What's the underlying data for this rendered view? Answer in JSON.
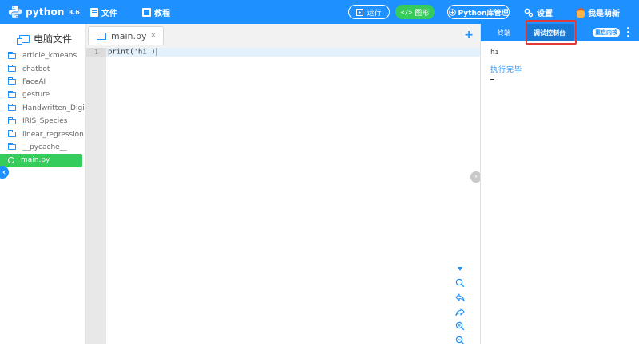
{
  "app": {
    "name": "python",
    "version": "3.6",
    "brand_color": "#1e90ff",
    "accent_green": "#36cc5c"
  },
  "topbar": {
    "file_label": "文件",
    "tutorial_label": "教程",
    "run_label": "运行",
    "graph_label": "图形",
    "lib_label": "Python库管理",
    "settings_label": "设置",
    "user_label": "我是萌新"
  },
  "sidebar": {
    "title": "电脑文件",
    "items": [
      {
        "label": "article_kmeans",
        "icon": "folder-icon"
      },
      {
        "label": "chatbot",
        "icon": "folder-icon"
      },
      {
        "label": "FaceAI",
        "icon": "folder-icon"
      },
      {
        "label": "gesture",
        "icon": "folder-icon"
      },
      {
        "label": "Handwritten_Digit...",
        "icon": "folder-icon"
      },
      {
        "label": "IRIS_Species",
        "icon": "folder-icon"
      },
      {
        "label": "linear_regression",
        "icon": "folder-icon"
      },
      {
        "label": "__pycache__",
        "icon": "folder-icon"
      },
      {
        "label": "main.py",
        "icon": "python-file-icon",
        "active": true
      }
    ]
  },
  "editor": {
    "tab_label": "main.py",
    "close_glyph": "×",
    "add_glyph": "+",
    "lines": [
      {
        "number": "1",
        "code": "print('hi')"
      }
    ]
  },
  "console": {
    "tab_terminal": "终端",
    "tab_debug": "调试控制台",
    "restart_label": "重启内核",
    "output_lines": [
      "hi",
      "执行完毕"
    ]
  }
}
